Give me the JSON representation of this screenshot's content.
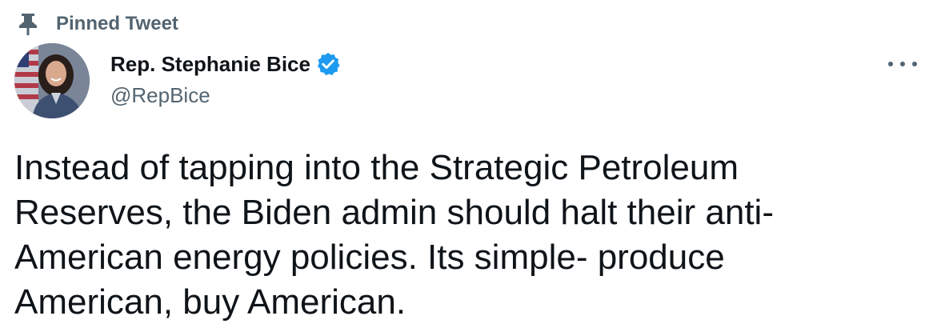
{
  "pinned": {
    "label": "Pinned Tweet",
    "icon": "pin-icon"
  },
  "author": {
    "display_name": "Rep. Stephanie Bice",
    "handle": "@RepBice",
    "verified": true,
    "verified_icon": "verified-badge-icon",
    "verified_color": "#1d9bf0"
  },
  "tweet": {
    "text": "Instead of tapping into the Strategic Petroleum\nReserves, the Biden admin should halt their anti-\nAmerican energy policies. Its simple- produce\nAmerican, buy American."
  },
  "menu": {
    "icon": "more-options-icon"
  },
  "colors": {
    "primary_text": "#0f1419",
    "secondary_text": "#536471",
    "accent": "#1d9bf0"
  }
}
